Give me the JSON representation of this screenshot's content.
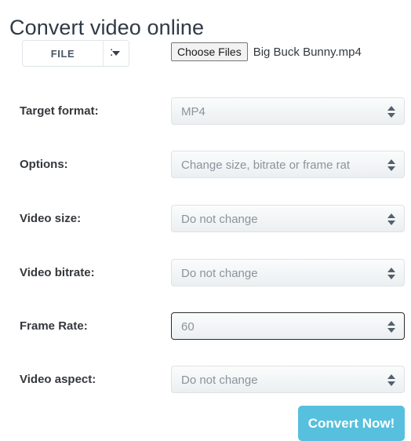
{
  "page": {
    "title": "Convert video online"
  },
  "source": {
    "mode_label": "FILE",
    "caret_icon": "chevron-down-icon",
    "separator": ":",
    "choose_files_label": "Choose Files",
    "file_name": "Big Buck Bunny.mp4"
  },
  "form": {
    "rows": [
      {
        "label": "Target format:",
        "value": "MP4",
        "focused": false,
        "name": "target-format"
      },
      {
        "label": "Options:",
        "value": "Change size, bitrate or frame rat",
        "focused": false,
        "name": "options"
      },
      {
        "label": "Video size:",
        "value": "Do not change",
        "focused": false,
        "name": "video-size"
      },
      {
        "label": "Video bitrate:",
        "value": "Do not change",
        "focused": false,
        "name": "video-bitrate"
      },
      {
        "label": "Frame Rate:",
        "value": "60",
        "focused": true,
        "name": "frame-rate"
      },
      {
        "label": "Video aspect:",
        "value": "Do not change",
        "focused": false,
        "name": "video-aspect"
      }
    ]
  },
  "submit": {
    "label": "Convert Now!"
  },
  "colors": {
    "accent": "#56c0de",
    "title": "#2f3a46",
    "label": "#35383c",
    "select_value": "#8b949c",
    "select_border": "#dde3e6",
    "focus_border": "#2b2b2b"
  }
}
